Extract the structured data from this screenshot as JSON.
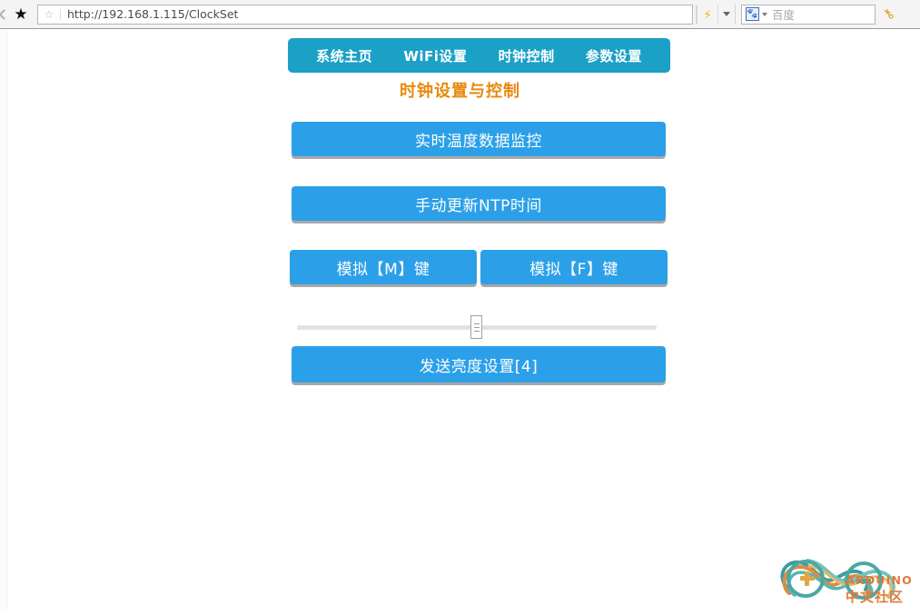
{
  "browser": {
    "back_icon": "back-arrow-icon",
    "bookmark_star_glyph": "★",
    "urlbar": {
      "star_glyph": "☆",
      "url": "http://192.168.1.115/ClockSet"
    },
    "bolt_glyph": "⚡",
    "search": {
      "engine_icon": "baidu-paw-icon",
      "engine_glyph": "🐾",
      "placeholder": "百度"
    },
    "key_glyph": "⚷"
  },
  "nav": {
    "items": [
      {
        "label": "系统主页",
        "name": "nav-home"
      },
      {
        "label": "WiFi设置",
        "name": "nav-wifi"
      },
      {
        "label": "时钟控制",
        "name": "nav-clock"
      },
      {
        "label": "参数设置",
        "name": "nav-params"
      }
    ]
  },
  "page": {
    "title": "时钟设置与控制",
    "title_color": "#e8890c",
    "nav_bg_color": "#1ba0c6",
    "button_color": "#2ba0e8"
  },
  "buttons": {
    "temperature_monitor": "实时温度数据监控",
    "ntp_update": "手动更新NTP时间",
    "key_m": "模拟【M】键",
    "key_f": "模拟【F】键",
    "send_brightness": "发送亮度设置[4]"
  },
  "slider": {
    "name": "brightness-slider",
    "value": 4,
    "position_percent": 50
  },
  "watermark": {
    "text_en": "ARDUINO",
    "text_cn": "中文社区"
  }
}
